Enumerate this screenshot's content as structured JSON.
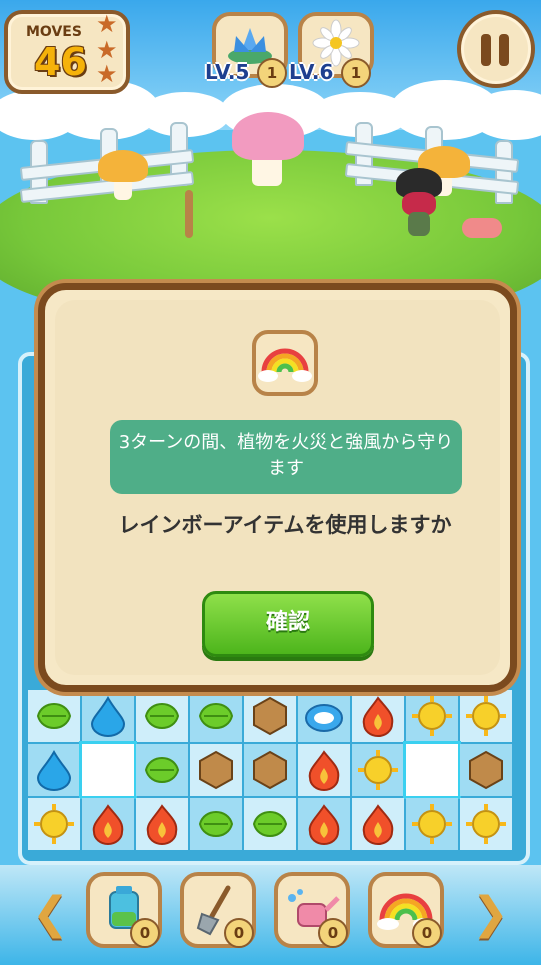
{
  "hud": {
    "moves_label": "MOVES",
    "moves_value": "46",
    "stars": 3,
    "goals": [
      {
        "icon": "blue-lotus-icon",
        "level_label": "LV.5",
        "count": "1"
      },
      {
        "icon": "white-daisy-icon",
        "level_label": "LV.6",
        "count": "1"
      }
    ],
    "pause_icon": "pause-icon"
  },
  "dialog": {
    "item_icon": "rainbow-icon",
    "description": "3ターンの間、植物を火災と強風から守ります",
    "question": "レインボーアイテムを使用しますか",
    "confirm_label": "確認"
  },
  "board": {
    "visible_rows": [
      [
        "leaf",
        "water",
        "leaf",
        "leaf",
        "nut",
        "cloud",
        "fire",
        "sun",
        "sun"
      ],
      [
        "water",
        "empty",
        "leaf",
        "nut",
        "nut",
        "fire",
        "sun",
        "empty",
        "nut"
      ],
      [
        "sun",
        "fire",
        "fire",
        "leaf",
        "leaf",
        "fire",
        "fire",
        "sun",
        "sun"
      ]
    ]
  },
  "toolbar": {
    "items": [
      {
        "icon": "fertilizer-bottle-icon",
        "count": "0"
      },
      {
        "icon": "shovel-icon",
        "count": "0"
      },
      {
        "icon": "watering-can-icon",
        "count": "0"
      },
      {
        "icon": "rainbow-icon",
        "count": "0"
      }
    ],
    "prev_icon": "chevron-left-icon",
    "next_icon": "chevron-right-icon"
  },
  "colors": {
    "confirm_green": "#4db51c",
    "description_bg": "#4fae88",
    "frame_brown": "#7b4a1e"
  }
}
